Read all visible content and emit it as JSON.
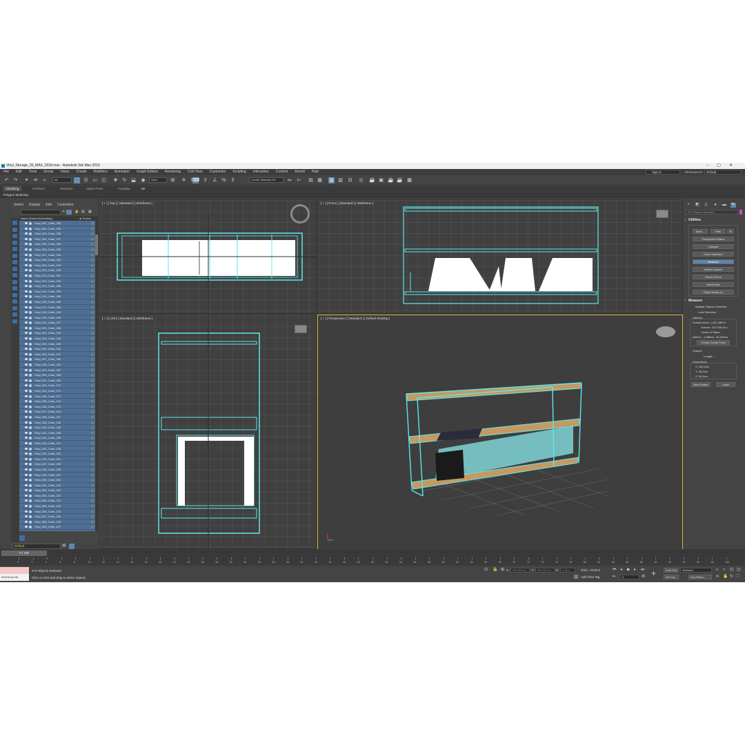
{
  "window": {
    "title": "Vinyl_Storage_20_MAX_2018.max - Autodesk 3ds Max 2019"
  },
  "menu": [
    "File",
    "Edit",
    "Tools",
    "Group",
    "Views",
    "Create",
    "Modifiers",
    "Animation",
    "Graph Editors",
    "Rendering",
    "Civil View",
    "Customize",
    "Scripting",
    "Interactive",
    "Content",
    "Arnold",
    "Help"
  ],
  "account": {
    "sign_in": "Sign In",
    "workspaces_label": "Workspaces:",
    "workspace": "Default"
  },
  "toolbar": {
    "filter": "All",
    "ref_coord": "View",
    "selection_set": "Create Selection Se"
  },
  "ribbon": {
    "tabs": [
      "Modeling",
      "Freeform",
      "Selection",
      "Object Paint",
      "Populate"
    ],
    "active_panel": "Polygon Modeling"
  },
  "explorer": {
    "menu": [
      "Select",
      "Display",
      "Edit",
      "Customize"
    ],
    "header_name": "Name (Sorted Ascending)",
    "header_frozen": "▲ Frozen",
    "rows": [
      "Vinyl_001_Cube_253",
      "Vinyl_002_Cube_299",
      "Vinyl_003_Cube_298",
      "Vinyl_004_Cube_297",
      "Vinyl_005_Cube_296",
      "Vinyl_006_Cube_295",
      "Vinyl_007_Cube_294",
      "Vinyl_009_Cube_300",
      "Vinyl_009_Cube_294",
      "Vinyl_010_Cube_293",
      "Vinyl_011_Cube_292",
      "Vinyl_012_Cube_292",
      "Vinyl_013_Cube_286",
      "Vinyl_014_Cube_299",
      "Vinyl_015_Cube_288",
      "Vinyl_016_Cube_266",
      "Vinyl_017_Cube_265",
      "Vinyl_018_Cube_215",
      "Vinyl_019_Cube_218",
      "Vinyl_020_Cube_217",
      "Vinyl_021_Cube_236",
      "Vinyl_022_Cube_218",
      "Vinyl_023_Cube_239",
      "Vinyl_024_Cube_263",
      "Vinyl_025_Cube_240",
      "Vinyl_026_Cube_241",
      "Vinyl_027_Cube_266",
      "Vinyl_028_Cube_242",
      "Vinyl_029_Cube_267",
      "Vinyl_030_Cube_268",
      "Vinyl_031_Cube_269",
      "Vinyl_032_Cube_270",
      "Vinyl_033_Cube_271",
      "Vinyl_034_Cube_272",
      "Vinyl_035_Cube_243",
      "Vinyl_036_Cube_273",
      "Vinyl_037_Cube_244",
      "Vinyl_038_Cube_257",
      "Vinyl_039_Cube_245",
      "Vinyl_040_Cube_246",
      "Vinyl_041_Cube_258",
      "Vinyl_042_Cube_259",
      "Vinyl_043_Cube_247",
      "Vinyl_044_Cube_248",
      "Vinyl_045_Cube_261",
      "Vinyl_046_Cube_261",
      "Vinyl_047_Cube_248",
      "Vinyl_048_Cube_266",
      "Vinyl_049_Cube_267",
      "Vinyl_050_Cube_284",
      "Vinyl_051_Cube_219",
      "Vinyl_052_Cube_220",
      "Vinyl_053_Cube_221",
      "Vinyl_054_Cube_222",
      "Vinyl_055_Cube_223",
      "Vinyl_056_Cube_224",
      "Vinyl_057_Cube_225",
      "Vinyl_058_Cube_226",
      "Vinyl_059_Cube_227",
      "Vinyl_060_Cube_228"
    ],
    "layer": "Default"
  },
  "viewports": {
    "top": "[ + ] [ Top ] [ Standard ] [ Wireframe ]",
    "front": "[ + ] [ Front ] [ Standard ] [ Wireframe ]",
    "left": "[ + ] [ Left ] [ Standard ] [ Wireframe ]",
    "perspective": "[ + ] [ Perspective ] [ Standard ] [ Default Shading ]"
  },
  "colors": {
    "wire": "#5ee8ec",
    "active_border": "#d5b23d",
    "selection": "#5b87ad",
    "wood": "#c49a62"
  },
  "cmd_panel": {
    "selection_field": "473 Objects Selected",
    "utilities": {
      "title": "Utilities",
      "more": "More...",
      "sets": "Sets",
      "buttons": [
        "Perspective Match",
        "Collapse",
        "Color Clipboard",
        "Measure",
        "Motion Capture",
        "Reset XForm",
        "MAXScript",
        "Flight Studio (c)"
      ]
    },
    "measure": {
      "title": "Measure",
      "multiple": "Multiple Objects Selected",
      "lock": "Lock Selection",
      "objects": "Objects",
      "surface_area": "Surface Area: 1.022.485,31",
      "volume": "Volume: 212.045,45 c",
      "center_label": "Center of Mass:",
      "center_value": "-,842cm, -1,886cm, 36,449cm",
      "create_center": "Create Center Point",
      "shapes": "Shapes",
      "length": "Length: ---",
      "dimensions": "Dimensions",
      "x": "X:  182,0cm",
      "y": "Y:  46,0cm",
      "z": "Z:  90,0cm",
      "new_floater": "New Floater",
      "close": "Close"
    }
  },
  "timeline": {
    "frame": "0 / 100",
    "ticks": [
      "0",
      "2",
      "4",
      "6",
      "8",
      "10",
      "12",
      "14",
      "16",
      "18",
      "20",
      "22",
      "24",
      "26",
      "28",
      "30",
      "32",
      "34",
      "36",
      "38",
      "40",
      "42",
      "44",
      "46",
      "48",
      "50",
      "52",
      "54",
      "56",
      "58",
      "60",
      "62",
      "64",
      "66",
      "68",
      "70",
      "72",
      "74",
      "76",
      "78",
      "80",
      "82",
      "84",
      "86",
      "88",
      "90",
      "92",
      "94",
      "96",
      "98",
      "100"
    ]
  },
  "status": {
    "maxscript": "MAXScript Mi",
    "objects_selected": "473 Objects Selected",
    "prompt": "Click or click-and-drag to select objects",
    "x_label": "X:",
    "y_label": "Y:",
    "z_label": "Z:",
    "x_val": "298,361cm",
    "y_val": "600,227cm",
    "z_val": "0,0cm",
    "grid": "Grid = 10,0cm",
    "add_time_tag": "Add Time Tag",
    "auto_key": "Auto Key",
    "selected": "Selected",
    "set_key": "Set Key",
    "key_filters": "Key Filters...",
    "frame_val": "0"
  }
}
